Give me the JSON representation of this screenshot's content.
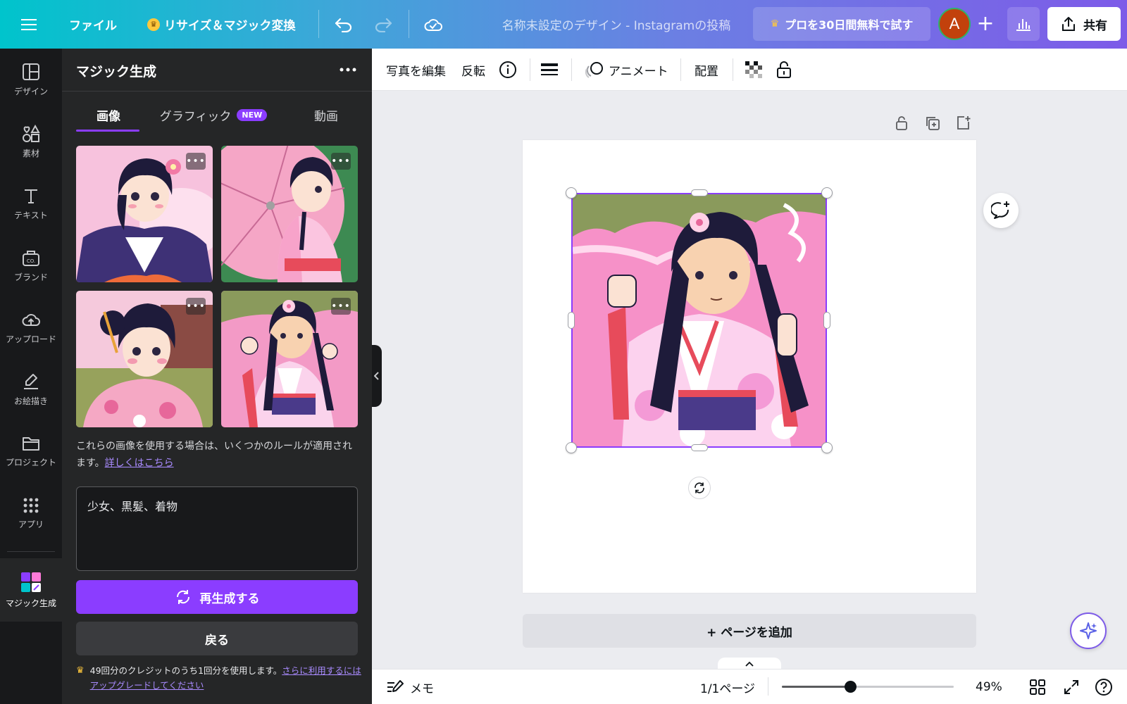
{
  "topbar": {
    "file_label": "ファイル",
    "resize_label": "リサイズ＆マジック変換",
    "doc_title": "名称未設定のデザイン - Instagramの投稿",
    "pro_label": "プロを30日間無料で試す",
    "avatar_letter": "A",
    "share_label": "共有"
  },
  "rail": {
    "items": [
      {
        "label": "デザイン",
        "icon": "layout-icon"
      },
      {
        "label": "素材",
        "icon": "elements-icon"
      },
      {
        "label": "テキスト",
        "icon": "text-icon"
      },
      {
        "label": "ブランド",
        "icon": "brand-icon"
      },
      {
        "label": "アップロード",
        "icon": "upload-cloud-icon"
      },
      {
        "label": "お絵描き",
        "icon": "draw-icon"
      },
      {
        "label": "プロジェクト",
        "icon": "folder-icon"
      },
      {
        "label": "アプリ",
        "icon": "apps-grid-icon"
      },
      {
        "label": "マジック生成",
        "icon": "magic-media-icon"
      }
    ]
  },
  "panel": {
    "title": "マジック生成",
    "tabs": [
      {
        "label": "画像"
      },
      {
        "label": "グラフィック",
        "badge": "NEW"
      },
      {
        "label": "動画"
      }
    ],
    "rules_text": "これらの画像を使用する場合は、いくつかのルールが適用されます。",
    "rules_link": "詳しくはこちら",
    "prompt_value": "少女、黒髪、着物",
    "regenerate_label": "再生成する",
    "back_label": "戻る",
    "credits_text": "49回分のクレジットのうち1回分を使用します。",
    "credits_link": "さらに利用するにはアップグレードしてください"
  },
  "ctx_toolbar": {
    "edit_photo": "写真を編集",
    "flip": "反転",
    "animate": "アニメート",
    "position": "配置"
  },
  "canvas": {
    "add_page": "+ ページを追加"
  },
  "bottom": {
    "notes": "メモ",
    "page_indicator": "1/1ページ",
    "zoom": "49%",
    "zoom_fraction": 0.4
  },
  "colors": {
    "accent": "#8b3dff",
    "panel_bg": "#252627",
    "rail_bg": "#18191b"
  }
}
